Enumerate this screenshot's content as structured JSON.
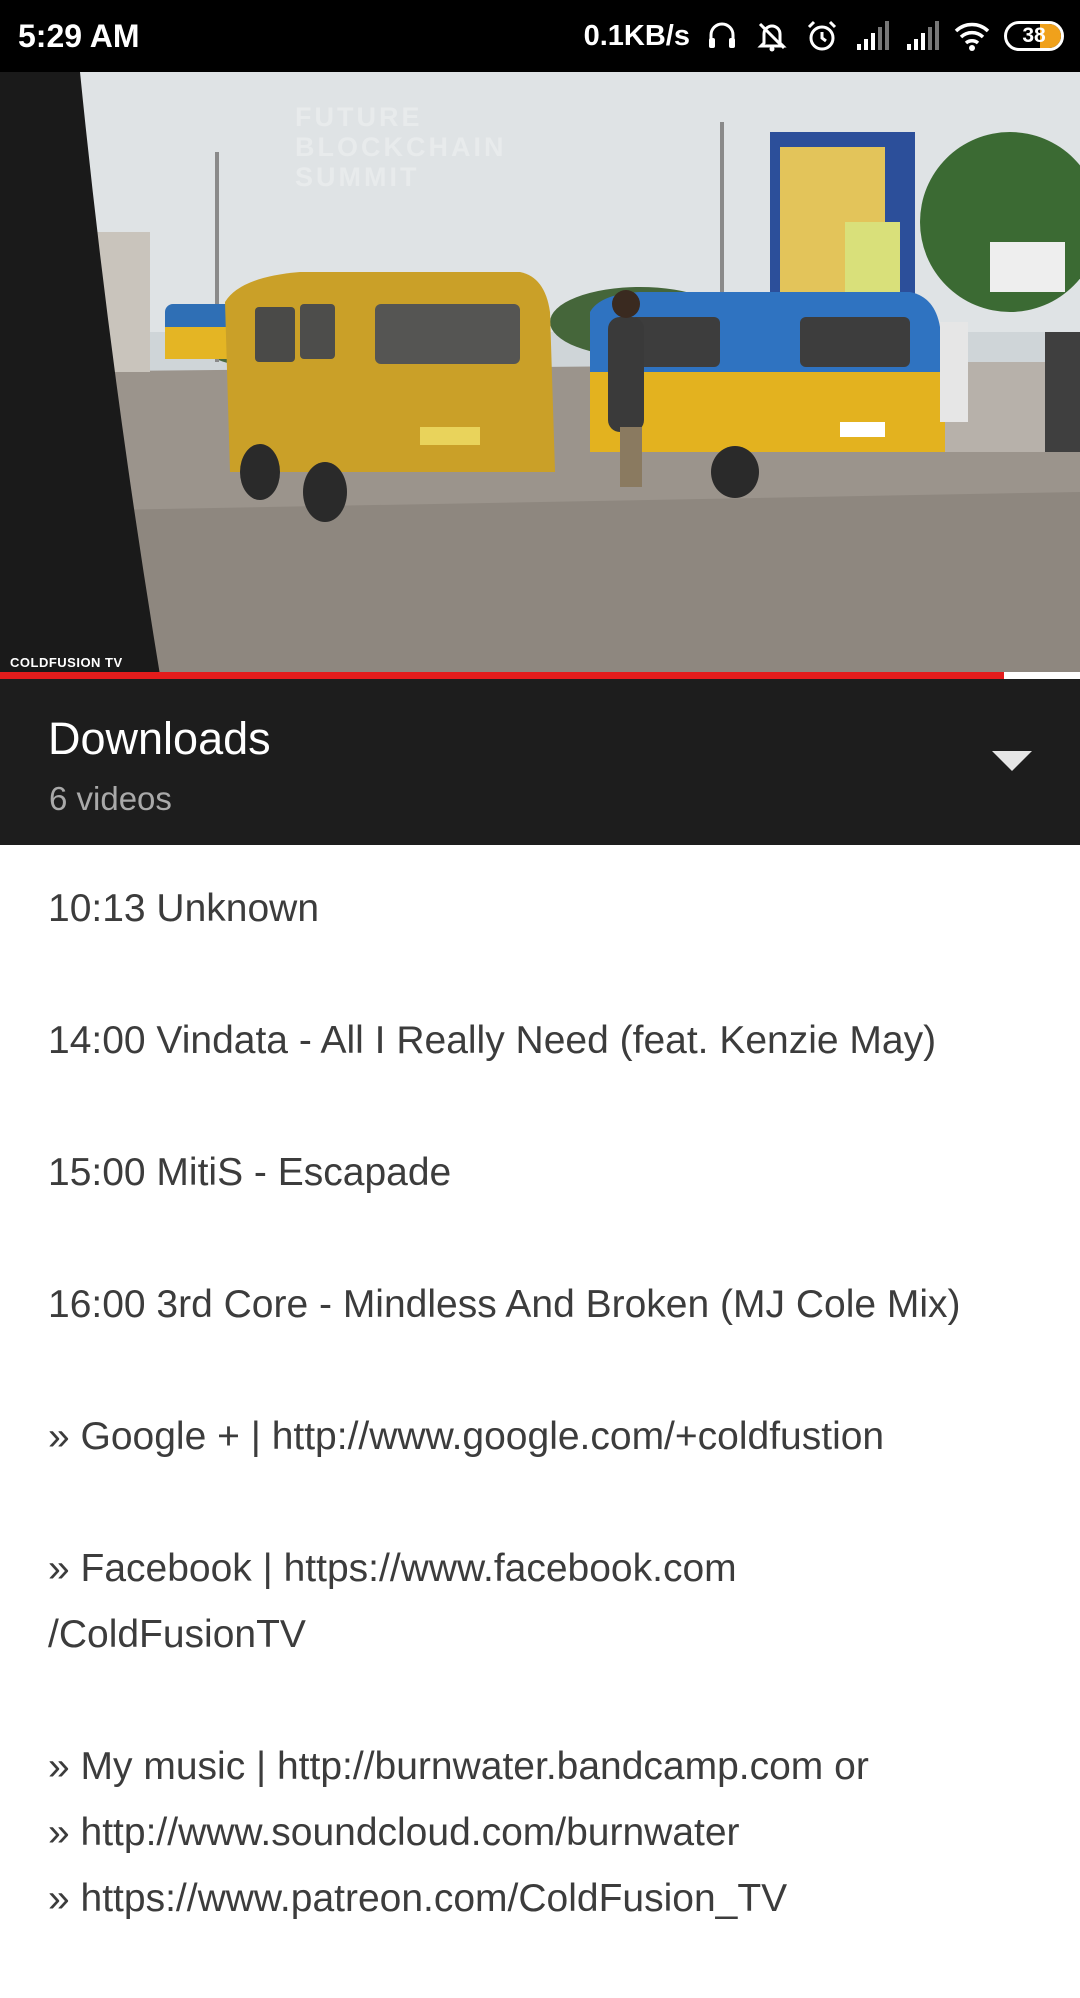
{
  "status_bar": {
    "time": "5:29 AM",
    "net_speed": "0.1KB/s",
    "battery_level": "38",
    "battery_fraction": 0.38,
    "icons": [
      "headset-icon",
      "mute-icon",
      "alarm-icon",
      "signal-icon",
      "signal-icon",
      "wifi-icon",
      "battery-icon"
    ]
  },
  "video": {
    "watermark": "COLDFUSION TV",
    "overlay_text": "FUTURE BLOCKCHAIN SUMMIT",
    "progress_fraction": 0.93,
    "progress_color": "#e31c1c"
  },
  "playlist": {
    "title": "Downloads",
    "count": "6 videos",
    "expand_icon": "chevron-down-icon"
  },
  "description": {
    "tracks": [
      "10:13 Unknown",
      "14:00 Vindata - All I Really Need (feat. Kenzie May)",
      "15:00 MitiS - Escapade",
      "16:00 3rd Core - Mindless And Broken (MJ Cole Mix)"
    ],
    "google_line": "» Google + | http://www.google.com/+coldfustion",
    "facebook_line_1": "» Facebook | https://www.facebook.com",
    "facebook_line_2": "/ColdFusionTV",
    "music_lines": [
      "» My music | http://burnwater.bandcamp.com or",
      "» http://www.soundcloud.com/burnwater",
      "» https://www.patreon.com/ColdFusion_TV"
    ]
  },
  "colors": {
    "status_bar_bg": "#000000",
    "header_bg": "#1d1d1d",
    "body_text": "#3c3c3c",
    "subtext": "#a9a9a9",
    "battery": "#f0a11b"
  }
}
